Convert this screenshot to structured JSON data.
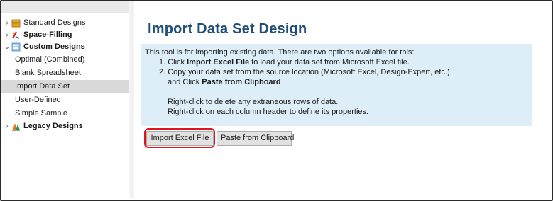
{
  "sidebar": {
    "tree": [
      {
        "label": "Standard Designs",
        "expanded": false,
        "icon": "standard-designs-icon"
      },
      {
        "label": "Space-Filling",
        "expanded": false,
        "icon": "space-filling-icon"
      },
      {
        "label": "Custom Designs",
        "expanded": true,
        "icon": "custom-designs-icon",
        "children": [
          "Optimal (Combined)",
          "Blank Spreadsheet",
          "Import Data Set",
          "User-Defined",
          "Simple Sample"
        ],
        "selected_child": "Import Data Set"
      },
      {
        "label": "Legacy Designs",
        "expanded": false,
        "icon": "legacy-designs-icon"
      }
    ]
  },
  "main": {
    "title": "Import Data Set Design",
    "info": {
      "intro": "This tool is for importing existing data. There are two options available for this:",
      "step1_prefix": "1. Click ",
      "step1_bold": "Import Excel File",
      "step1_suffix": " to load your data set from Microsoft Excel file.",
      "step2_line1": "2. Copy your data set from the source location (Microsoft Excel, Design-Expert, etc.)",
      "step2_prefix": "and Click ",
      "step2_bold": "Paste from Clipboard",
      "note1": "Right-click to delete any extraneous rows of data.",
      "note2": "Right-click on each column header to define its properties."
    },
    "buttons": {
      "import": "Import Excel File",
      "paste": "Paste from Clipboard"
    }
  },
  "colors": {
    "title": "#1f4e79",
    "info_background": "#ddeef8",
    "highlight": "#e0161f",
    "selection": "#d9d9d9"
  }
}
